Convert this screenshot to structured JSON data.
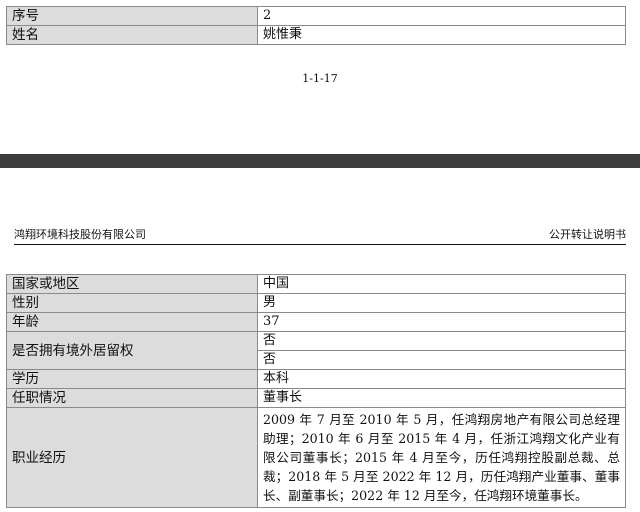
{
  "top_table": [
    {
      "label": "序号",
      "value": "2"
    },
    {
      "label": "姓名",
      "value": "姚惟秉"
    }
  ],
  "page_number": "1-1-17",
  "header": {
    "company": "鸿翔环境科技股份有限公司",
    "doc_type": "公开转让说明书"
  },
  "main_table": {
    "country_label": "国家或地区",
    "country_value": "中国",
    "gender_label": "性别",
    "gender_value": "男",
    "age_label": "年龄",
    "age_value": "37",
    "residency_label": "是否拥有境外居留权",
    "residency_values": [
      "否",
      "否"
    ],
    "education_label": "学历",
    "education_value": "本科",
    "position_label": "任职情况",
    "position_value": "董事长",
    "career_label": "职业经历",
    "career_value": "2009 年 7 月至 2010 年 5 月，任鸿翔房地产有限公司总经理助理；2010 年 6 月至 2015 年 4 月，任浙江鸿翔文化产业有限公司董事长；2015 年 4 月至今，历任鸿翔控股副总裁、总裁；2018 年 5 月至 2022 年 12 月，历任鸿翔产业董事、董事长、副董事长；2022 年 12 月至今，任鸿翔环境董事长。"
  }
}
